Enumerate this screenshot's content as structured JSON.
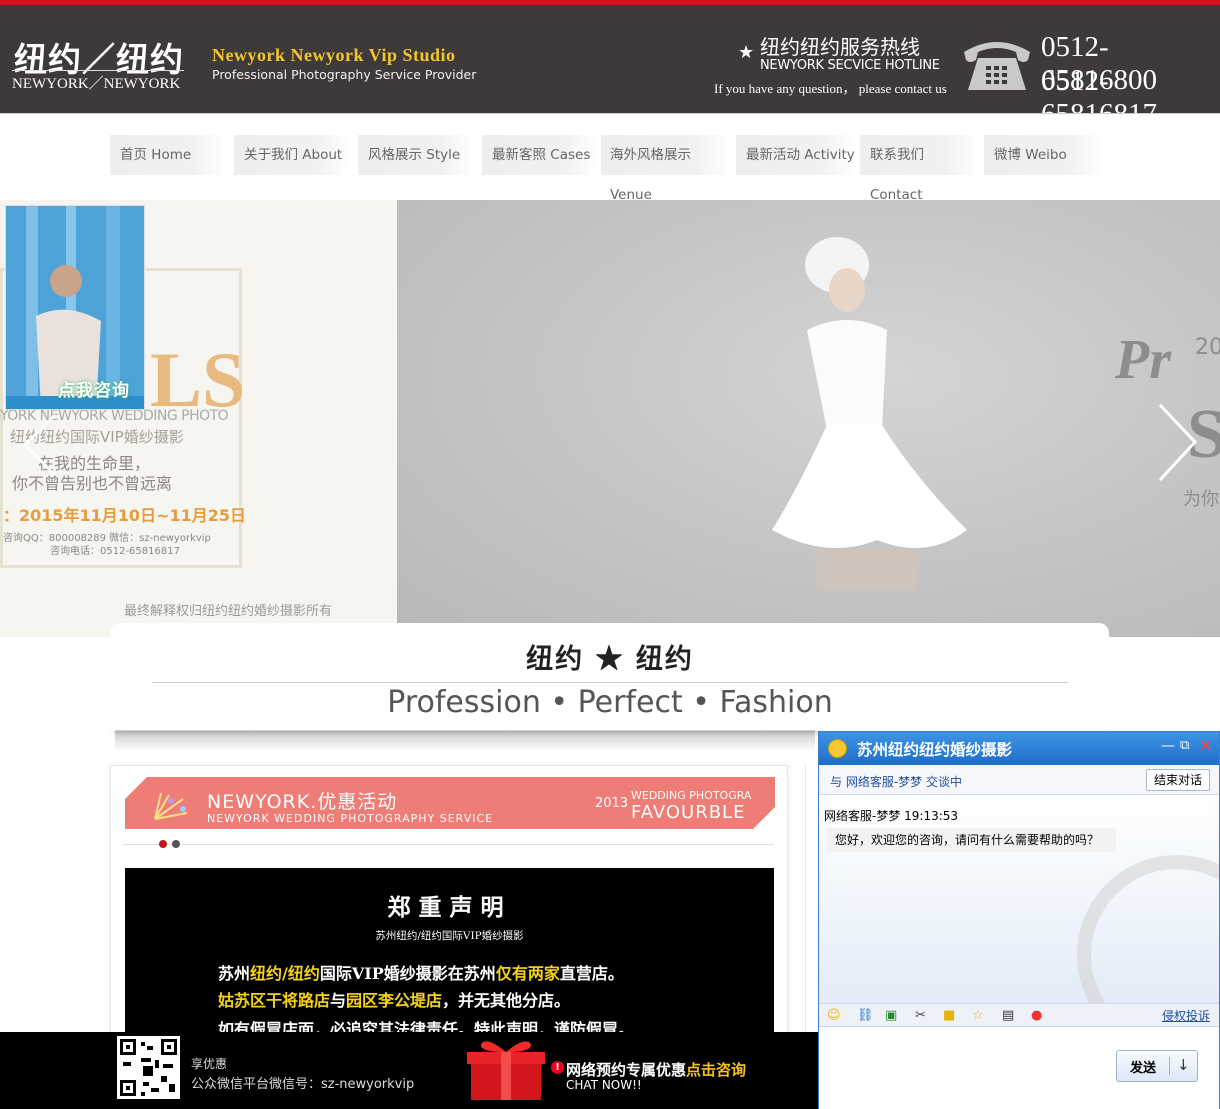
{
  "header": {
    "logo_cn": "纽约／纽约",
    "logo_en": "NEWYORK／NEWYORK",
    "studio_name": "Newyork Newyork Vip Studio",
    "studio_sub": "Professional Photography Service Provider",
    "hotline_cn": "纽约纽约服务热线",
    "hotline_en": "NEWYORK SECVICE HOTLINE",
    "hotline_note": "If you have any question， please contact us",
    "phone1": "0512-65816800",
    "phone2": "0512-65816817",
    "star_icon": "★",
    "phone_icon": "telephone-icon"
  },
  "nav": {
    "items": [
      {
        "label": "首页 Home"
      },
      {
        "label": "关于我们 About"
      },
      {
        "label": "风格展示 Style"
      },
      {
        "label": "最新客照 Cases"
      },
      {
        "label": "海外风格展示 Venue"
      },
      {
        "label": "最新活动 Activity"
      },
      {
        "label": "联系我们 Contact"
      },
      {
        "label": "微博 Weibo"
      }
    ]
  },
  "banner": {
    "big_text": "LS",
    "en_text": "YORK NEWYORK WEDDING PHOTO",
    "cn_title": "纽约纽约国际VIP婚纱摄影",
    "quote1": "在我的生命里，",
    "quote2": "你不曾告别也不曾远离",
    "date": "：2015年11月10日~11月25日",
    "qq": "咨询QQ：800008289  微信：sz-newyorkvip",
    "tel": "咨询电话：0512-65816817",
    "disclaimer": "最终解释权归纽约纽约婚纱摄影所有",
    "side_text": "Pr",
    "side_year": "20",
    "side_s": "S",
    "side_cn": "为你",
    "consult_label": "点我咨询",
    "prev_icon": "chevron-left-icon",
    "next_icon": "chevron-right-icon"
  },
  "slogan": {
    "title": "纽约 ★ 纽约",
    "subtitle": "Profession • Perfect • Fashion"
  },
  "promo": {
    "title": "NEWYORK.优惠活动",
    "subtitle": "NEWYORK WEDDING PHOTOGRAPHY SERVICE",
    "year": "2013",
    "en1": "WEDDING PHOTOGRA",
    "en2": "FAVOURBLE",
    "notice_title": "郑重声明",
    "notice_sub": "苏州纽约/纽约国际VIP婚纱摄影",
    "line1_a": "苏州",
    "line1_b": "纽约/纽约",
    "line1_c": "国际VIP婚纱摄影在苏州",
    "line1_d": "仅有两家",
    "line1_e": "直营店。",
    "line2_a": "姑苏区干将路店",
    "line2_b": "与",
    "line2_c": "园区李公堤店",
    "line2_d": "，并无其他分店。",
    "line3": "如有假冒店面，必追究其法律责任。特此声明，谨防假冒。"
  },
  "bottom_bar": {
    "text1": "享优惠",
    "text2": "公众微信平台微信号：sz-newyorkvip",
    "cta_prefix": "网络预约专属优惠",
    "cta_link": "点击咨询",
    "chat_now": "CHAT NOW!!"
  },
  "chat": {
    "title": "苏州纽约纽约婚纱摄影",
    "with_prefix": "与",
    "agent": "网络客服-梦梦",
    "with_suffix": "交谈中",
    "end_button": "结束对话",
    "meta": "网络客服-梦梦 19:13:53",
    "message": "您好，欢迎您的咨询，请问有什么需要帮助的吗？",
    "report": "侵权投诉",
    "send": "发送",
    "send_arrow": "↓",
    "min_icon": "—",
    "max_icon": "⧉",
    "close_icon": "✕"
  }
}
